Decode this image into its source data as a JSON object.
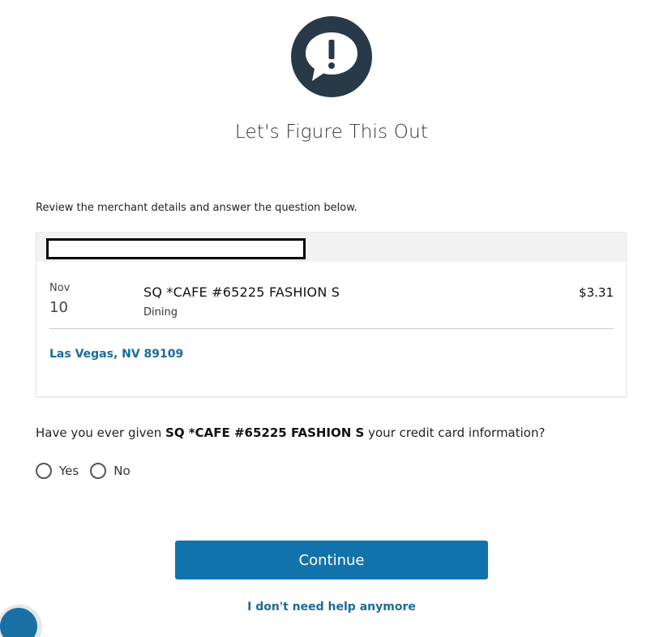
{
  "heading": "Let's Figure This Out",
  "instructions": "Review the merchant details and answer the question below.",
  "transaction": {
    "month": "Nov",
    "day": "10",
    "merchant": "SQ *CAFE #65225 FASHION S",
    "category": "Dining",
    "amount": "$3.31",
    "location": "Las Vegas, NV 89109"
  },
  "question": {
    "prefix": "Have you ever given ",
    "merchant": "SQ *CAFE #65225 FASHION S",
    "suffix": " your credit card information?"
  },
  "options": {
    "yes": "Yes",
    "no": "No"
  },
  "buttons": {
    "continue": "Continue",
    "no_help": "I don't need help anymore"
  },
  "icons": {
    "alert": "speech-bubble-exclamation-icon",
    "chat": "chat-widget-icon"
  },
  "colors": {
    "icon_dark": "#283a47",
    "primary": "#1272ac",
    "link": "#1a6b9a"
  }
}
